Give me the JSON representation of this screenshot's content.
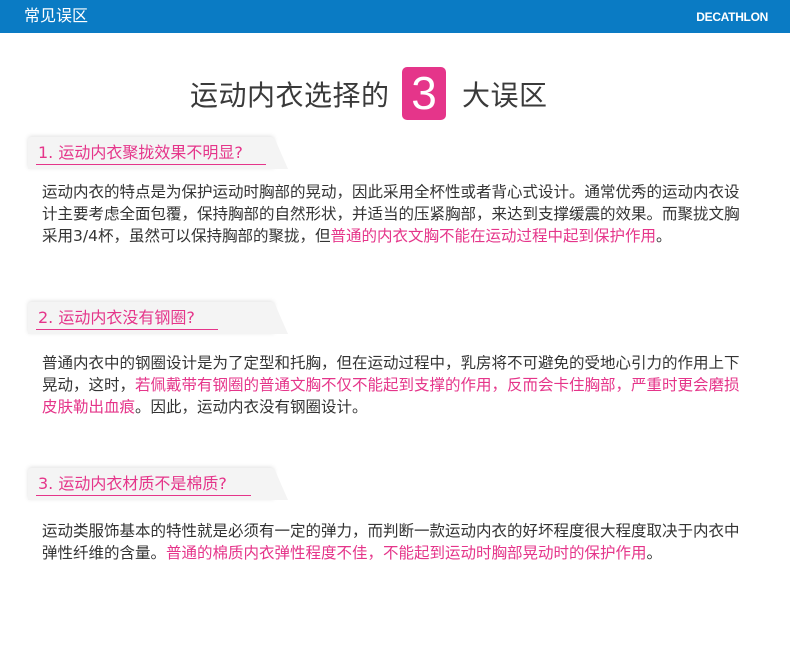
{
  "header": {
    "title": "常见误区",
    "brand": "DECATHLON"
  },
  "heading": {
    "before": "运动内衣选择的",
    "number": "3",
    "after": "大误区"
  },
  "sections": [
    {
      "title": "1. 运动内衣聚拢效果不明显?",
      "text_normal": "运动内衣的特点是为保护运动时胸部的晃动，因此采用全杯性或者背心式设计。通常优秀的运动内衣设计主要考虑全面包覆，保持胸部的自然形状，并适当的压紧胸部，来达到支撑缓震的效果。而聚拢文胸采用3/4杯，虽然可以保持胸部的聚拢，但",
      "text_highlight": "普通的内衣文胸不能在运动过程中起到保护作用",
      "text_after": "。"
    },
    {
      "title": "2. 运动内衣没有钢圈?",
      "text_normal": "普通内衣中的钢圈设计是为了定型和托胸，但在运动过程中，乳房将不可避免的受地心引力的作用上下晃动，这时，",
      "text_highlight": "若佩戴带有钢圈的普通文胸不仅不能起到支撑的作用，反而会卡住胸部，严重时更会磨损皮肤勒出血痕",
      "text_after": "。因此，运动内衣没有钢圈设计。"
    },
    {
      "title": "3. 运动内衣材质不是棉质?",
      "text_normal": "运动类服饰基本的特性就是必须有一定的弹力，而判断一款运动内衣的好坏程度很大程度取决于内衣中弹性纤维的含量。",
      "text_highlight": "普通的棉质内衣弹性程度不佳，不能起到运动时胸部晃动时的保护作用",
      "text_after": "。"
    }
  ],
  "colors": {
    "header_bg": "#0a7bc4",
    "accent": "#e5358a",
    "card_bg": "#f4f4f4",
    "text": "#333333"
  }
}
